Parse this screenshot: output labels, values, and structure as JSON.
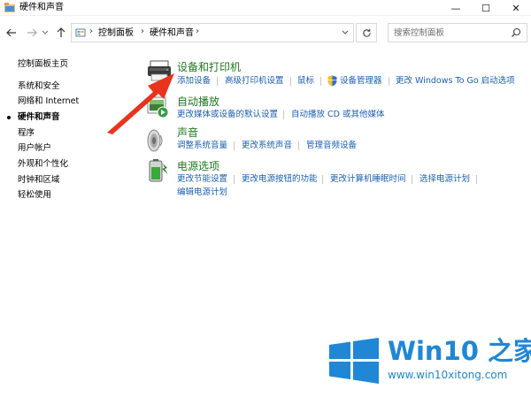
{
  "window": {
    "title": "硬件和声音",
    "minimize": "—",
    "maximize": "☐",
    "close": "✕"
  },
  "addressbar": {
    "crumbs": [
      "控制面板",
      "硬件和声音"
    ],
    "separator": "›",
    "search_placeholder": "搜索控制面板"
  },
  "leftnav": {
    "items": [
      {
        "label": "控制面板主页"
      },
      {
        "label": "系统和安全"
      },
      {
        "label": "网络和 Internet"
      },
      {
        "label": "硬件和声音",
        "current": true
      },
      {
        "label": "程序"
      },
      {
        "label": "用户帐户"
      },
      {
        "label": "外观和个性化"
      },
      {
        "label": "时钟和区域"
      },
      {
        "label": "轻松使用"
      }
    ]
  },
  "categories": [
    {
      "title": "设备和打印机",
      "icon": "printer-icon",
      "links": [
        "添加设备",
        "高级打印机设置",
        "鼠标",
        "设备管理器",
        "更改 Windows To Go 启动选项"
      ]
    },
    {
      "title": "自动播放",
      "icon": "autoplay-icon",
      "links": [
        "更改媒体或设备的默认设置",
        "自动播放 CD 或其他媒体"
      ]
    },
    {
      "title": "声音",
      "icon": "speaker-icon",
      "links": [
        "调整系统音量",
        "更改系统声音",
        "管理音频设备"
      ]
    },
    {
      "title": "电源选项",
      "icon": "battery-icon",
      "links": [
        "更改节能设置",
        "更改电源按钮的功能",
        "更改计算机睡眠时间",
        "选择电源计划",
        "编辑电源计划"
      ]
    }
  ],
  "annotation": {
    "arrow_color": "#e8341c"
  },
  "watermark": {
    "brand": "Win10 之家",
    "url": "www.win10xitong.com",
    "color": "#1f87d6"
  }
}
